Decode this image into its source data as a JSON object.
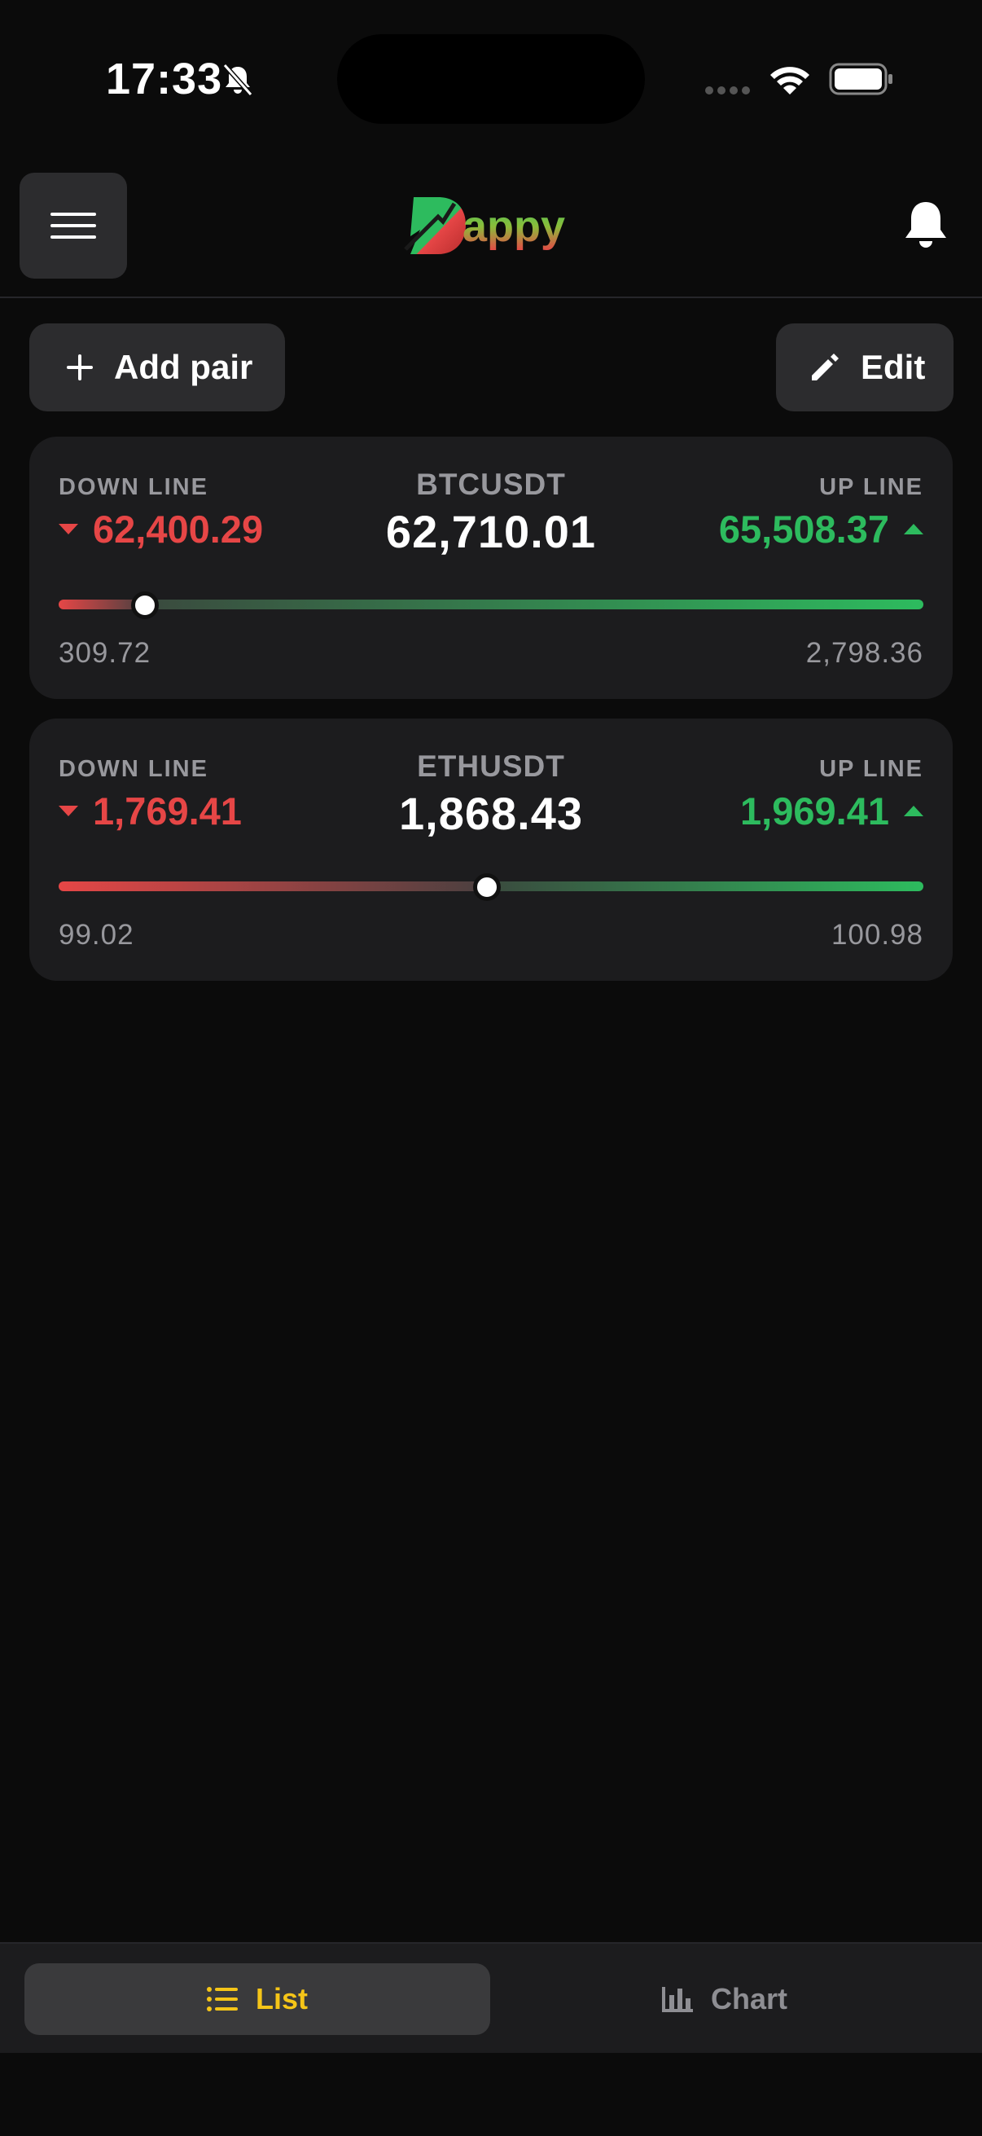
{
  "status_bar": {
    "time": "17:33"
  },
  "header": {
    "logo_text": "Dappy"
  },
  "actions": {
    "add_label": "Add pair",
    "edit_label": "Edit"
  },
  "pairs": [
    {
      "name": "BTCUSDT",
      "price": "62,710.01",
      "down_label": "DOWN LINE",
      "down_value": "62,400.29",
      "up_label": "UP LINE",
      "up_value": "65,508.37",
      "range_low": "309.72",
      "range_high": "2,798.36",
      "position": 0.1
    },
    {
      "name": "ETHUSDT",
      "price": "1,868.43",
      "down_label": "DOWN LINE",
      "down_value": "1,769.41",
      "up_label": "UP LINE",
      "up_value": "1,969.41",
      "range_low": "99.02",
      "range_high": "100.98",
      "position": 0.495
    }
  ],
  "tabs": {
    "list_label": "List",
    "chart_label": "Chart",
    "active": "list"
  },
  "colors": {
    "down": "#e64646",
    "up": "#2dbb5e",
    "accent": "#f5c518"
  }
}
